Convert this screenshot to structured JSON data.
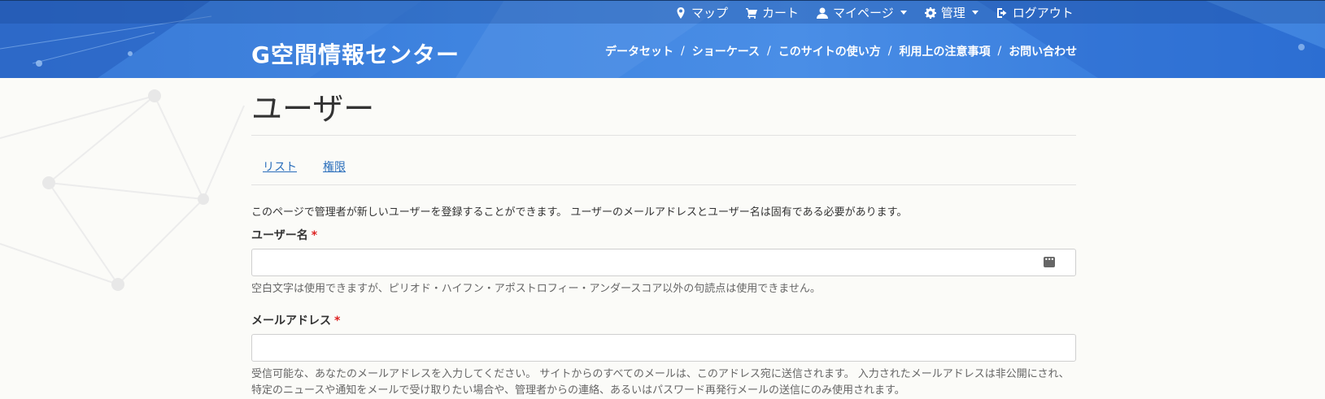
{
  "top_nav": [
    {
      "icon": "map-marker-icon",
      "label": "マップ",
      "dropdown": false
    },
    {
      "icon": "cart-icon",
      "label": "カート",
      "dropdown": false
    },
    {
      "icon": "user-icon",
      "label": "マイページ",
      "dropdown": true
    },
    {
      "icon": "gear-icon",
      "label": "管理",
      "dropdown": true
    },
    {
      "icon": "logout-icon",
      "label": "ログアウト",
      "dropdown": false
    }
  ],
  "logo": "G空間情報センター",
  "main_nav": [
    "データセット",
    "ショーケース",
    "このサイトの使い方",
    "利用上の注意事項",
    "お問い合わせ"
  ],
  "main_nav_separator": "/",
  "page_title": "ユーザー",
  "tabs": [
    "リスト",
    "権限"
  ],
  "intro": "このページで管理者が新しいユーザーを登録することができます。 ユーザーのメールアドレスとユーザー名は固有である必要があります。",
  "form": {
    "username": {
      "label": "ユーザー名",
      "required_mark": "*",
      "value": "",
      "help": "空白文字は使用できますが、ピリオド・ハイフン・アポストロフィー・アンダースコア以外の句読点は使用できません。"
    },
    "email": {
      "label": "メールアドレス",
      "required_mark": "*",
      "value": "",
      "help": "受信可能な、あなたのメールアドレスを入力してください。 サイトからのすべてのメールは、このアドレス宛に送信されます。 入力されたメールアドレスは非公開にされ、特定のニュースや通知をメールで受け取りたい場合や、管理者からの連絡、あるいはパスワード再発行メールの送信にのみ使用されます。"
    }
  },
  "colors": {
    "header": "#3f84e0",
    "link": "#2a6ebb",
    "required": "#dd2222"
  }
}
